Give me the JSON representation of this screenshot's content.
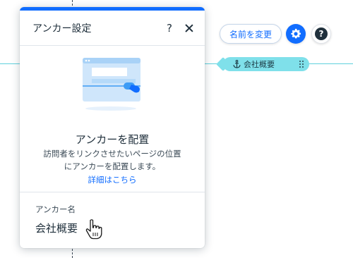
{
  "canvas": {
    "anchor_tag": {
      "label": "会社概要",
      "icon": "anchor-icon"
    }
  },
  "toolbar": {
    "rename_label": "名前を変更",
    "settings_icon": "gear-icon",
    "help_label": "?"
  },
  "panel": {
    "title": "アンカー設定",
    "help_label": "?",
    "close_icon": "close-icon",
    "placement_title": "アンカーを配置",
    "description_line1": "訪問者をリンクさせたいページの位置",
    "description_line2": "にアンカーを配置します。",
    "details_link": "詳細はこちら",
    "name_label": "アンカー名",
    "name_value": "会社概要"
  },
  "colors": {
    "accent": "#116dff",
    "anchor_line": "#5fd0dc",
    "anchor_tag": "#7fe0ea"
  }
}
